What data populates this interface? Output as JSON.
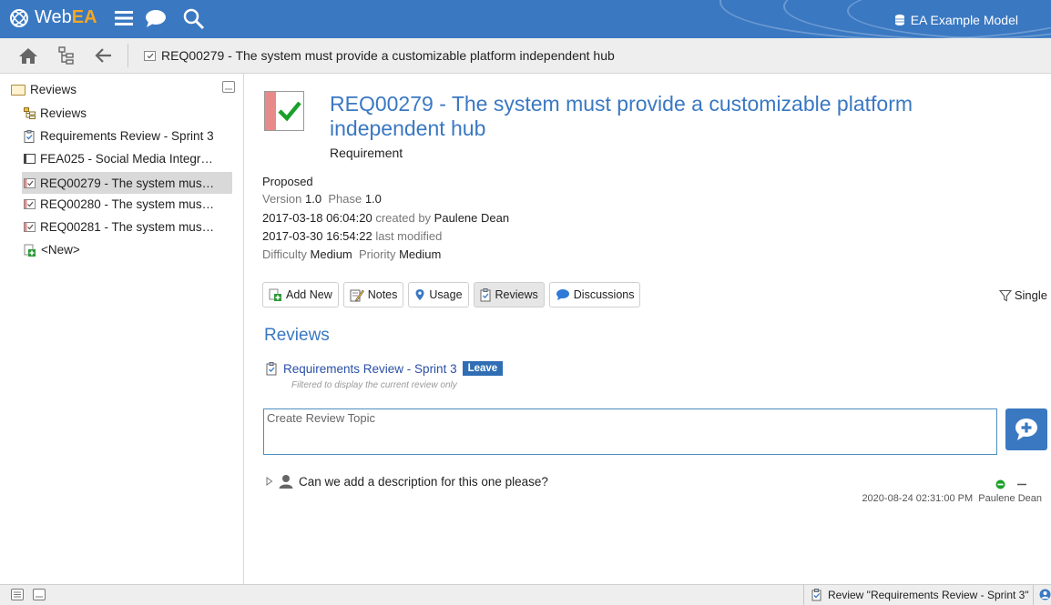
{
  "app": {
    "logo_prefix": "Web",
    "logo_suffix": "EA",
    "model_name": "EA Example Model"
  },
  "toolbar": {
    "breadcrumb": "REQ00279 - The system must provide a customizable platform independent hub"
  },
  "sidebar": {
    "root_label": "Reviews",
    "items": [
      {
        "label": "Reviews",
        "icon": "package-diagram-icon"
      },
      {
        "label": "Requirements Review - Sprint 3",
        "icon": "review-icon"
      },
      {
        "label": "FEA025 - Social Media Integr…",
        "icon": "feature-icon"
      },
      {
        "label": "REQ00279 - The system mus…",
        "icon": "requirement-icon",
        "selected": true
      },
      {
        "label": "REQ00280 - The system mus…",
        "icon": "requirement-icon"
      },
      {
        "label": "REQ00281 - The system mus…",
        "icon": "requirement-icon"
      },
      {
        "label": "<New>",
        "icon": "new-item-icon"
      }
    ]
  },
  "element": {
    "title": "REQ00279 - The system must provide a customizable platform independent hub",
    "type": "Requirement",
    "status": "Proposed",
    "version_label": "Version",
    "version": "1.0",
    "phase_label": "Phase",
    "phase": "1.0",
    "created_date": "2017-03-18 06:04:20",
    "created_label": "created by",
    "created_by": "Paulene Dean",
    "modified_date": "2017-03-30 16:54:22",
    "modified_label": "last modified",
    "difficulty_label": "Difficulty",
    "difficulty": "Medium",
    "priority_label": "Priority",
    "priority": "Medium"
  },
  "buttons": {
    "add_new": "Add New",
    "notes": "Notes",
    "usage": "Usage",
    "reviews": "Reviews",
    "discussions": "Discussions",
    "single": "Single"
  },
  "reviews": {
    "heading": "Reviews",
    "review_name": "Requirements Review - Sprint 3",
    "leave_label": "Leave",
    "filter_note": "Filtered to display the current review only",
    "topic_placeholder": "Create Review Topic",
    "topics": [
      {
        "text": "Can we add a description for this one please?",
        "timestamp": "2020-08-24 02:31:00 PM",
        "author": "Paulene Dean"
      }
    ]
  },
  "statusbar": {
    "review_text": "Review \"Requirements Review - Sprint 3\""
  },
  "colors": {
    "brand_blue": "#3a78c2",
    "logo_accent": "#f5a623",
    "check_green": "#1aa12a",
    "status_green": "#1aa12a"
  }
}
